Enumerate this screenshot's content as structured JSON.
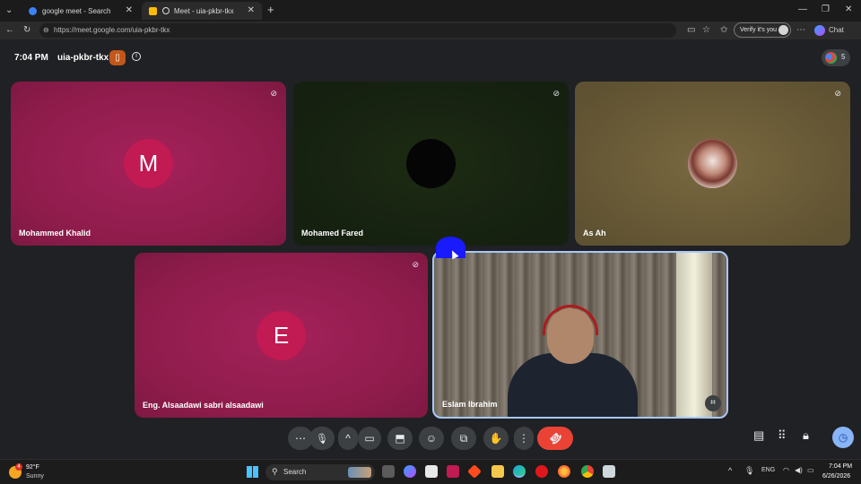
{
  "browser": {
    "tabs": [
      {
        "title": "google meet - Search",
        "active": false
      },
      {
        "title": "Meet - uia-pkbr-tkx",
        "active": true
      }
    ],
    "new_tab_label": "+",
    "url": "https://meet.google.com/uia-pkbr-tkx",
    "verify_label": "Verify it's you",
    "copilot_label": "Chat",
    "window_controls": [
      "—",
      "❐",
      "✕"
    ]
  },
  "meeting": {
    "time": "7:04 PM",
    "code": "uia-pkbr-tkx",
    "participant_count": "5"
  },
  "tiles": [
    {
      "name": "Mohammed Khalid",
      "initial": "M",
      "muted": true
    },
    {
      "name": "Mohamed Fared",
      "initial": "",
      "muted": true
    },
    {
      "name": "As Ah",
      "initial": "",
      "muted": true
    },
    {
      "name": "Eng. Alsaadawi sabri alsaadawi",
      "initial": "E",
      "muted": true
    },
    {
      "name": "Eslam Ibrahim",
      "initial": "",
      "muted": false,
      "video": true
    }
  ],
  "controls": {
    "more": "⋯",
    "mic": "🎙",
    "expand": "^",
    "camera": "▭",
    "present": "⬒",
    "emoji": "☺",
    "captions": "⧉",
    "hand": "✋",
    "options": "⋮",
    "leave": "☎"
  },
  "taskbar": {
    "weather_temp": "92°F",
    "weather_desc": "Sunny",
    "weather_badge": "4",
    "search_label": "Search",
    "lang": "ENG",
    "time": "7:04 PM",
    "date": "6/26/2026"
  },
  "colors": {
    "accent_red": "#ea4335",
    "tile_pink": "#9c1c4e",
    "tile_green": "#172310",
    "tile_olive": "#6e5e38",
    "speaker_border": "#a8c7fa"
  }
}
